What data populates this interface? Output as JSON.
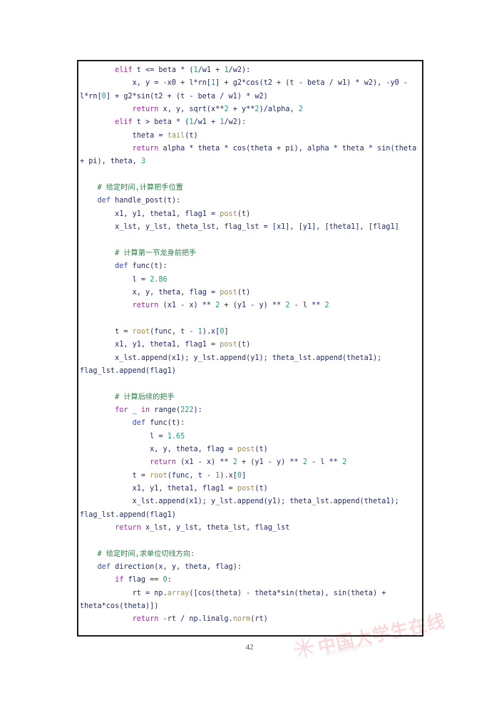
{
  "page": {
    "number": "42",
    "language": "python"
  },
  "watermark": {
    "star": "✳",
    "text_cn": "中国大学生在线",
    "url": "dxs.moe.gov.cn"
  },
  "code": {
    "lines": [
      [
        {
          "t": "        ",
          "c": "op"
        },
        {
          "t": "elif",
          "c": "kw"
        },
        {
          "t": " t <= beta * (",
          "c": "id"
        },
        {
          "t": "1",
          "c": "num"
        },
        {
          "t": "/w1 + ",
          "c": "id"
        },
        {
          "t": "1",
          "c": "num"
        },
        {
          "t": "/w2):",
          "c": "id"
        }
      ],
      [
        {
          "t": "            x, y = -x0 + l*rn[",
          "c": "id"
        },
        {
          "t": "1",
          "c": "num"
        },
        {
          "t": "] + g2*cos(t2 + (t - beta / w1) * w2), -y0 - l*rn[",
          "c": "id"
        },
        {
          "t": "0",
          "c": "num"
        },
        {
          "t": "] + g2*sin(t2 + (t - beta / w1) * w2)",
          "c": "id"
        }
      ],
      [
        {
          "t": "            ",
          "c": "op"
        },
        {
          "t": "return",
          "c": "kw"
        },
        {
          "t": " x, y, ",
          "c": "id"
        },
        {
          "t": "sqrt",
          "c": "id"
        },
        {
          "t": "(x**",
          "c": "id"
        },
        {
          "t": "2",
          "c": "num"
        },
        {
          "t": " + y**",
          "c": "id"
        },
        {
          "t": "2",
          "c": "num"
        },
        {
          "t": ")/alpha, ",
          "c": "id"
        },
        {
          "t": "2",
          "c": "num"
        }
      ],
      [
        {
          "t": "        ",
          "c": "op"
        },
        {
          "t": "elif",
          "c": "kw"
        },
        {
          "t": " t > beta * (",
          "c": "id"
        },
        {
          "t": "1",
          "c": "num"
        },
        {
          "t": "/w1 + ",
          "c": "id"
        },
        {
          "t": "1",
          "c": "num"
        },
        {
          "t": "/w2):",
          "c": "id"
        }
      ],
      [
        {
          "t": "            theta = ",
          "c": "id"
        },
        {
          "t": "tail",
          "c": "fn"
        },
        {
          "t": "(t)",
          "c": "id"
        }
      ],
      [
        {
          "t": "            ",
          "c": "op"
        },
        {
          "t": "return",
          "c": "kw"
        },
        {
          "t": " alpha * theta * cos(theta + pi), alpha * theta * sin(theta + pi), theta, ",
          "c": "id"
        },
        {
          "t": "3",
          "c": "num"
        }
      ],
      [],
      [
        {
          "t": "    ",
          "c": "op"
        },
        {
          "t": "# 给定时间,计算把手位置",
          "c": "com"
        }
      ],
      [
        {
          "t": "    ",
          "c": "op"
        },
        {
          "t": "def",
          "c": "kwd"
        },
        {
          "t": " handle_post(t):",
          "c": "id"
        }
      ],
      [
        {
          "t": "        x1, y1, theta1, flag1 = ",
          "c": "id"
        },
        {
          "t": "post",
          "c": "fn"
        },
        {
          "t": "(t)",
          "c": "id"
        }
      ],
      [
        {
          "t": "        x_lst, y_lst, theta_lst, flag_lst = [x1], [y1], [theta1], [flag1]",
          "c": "id"
        }
      ],
      [],
      [
        {
          "t": "        ",
          "c": "op"
        },
        {
          "t": "# 计算第一节龙身前把手",
          "c": "com"
        }
      ],
      [
        {
          "t": "        ",
          "c": "op"
        },
        {
          "t": "def",
          "c": "kwd"
        },
        {
          "t": " func(t):",
          "c": "id"
        }
      ],
      [
        {
          "t": "            l = ",
          "c": "id"
        },
        {
          "t": "2.86",
          "c": "num"
        }
      ],
      [
        {
          "t": "            x, y, theta, flag = ",
          "c": "id"
        },
        {
          "t": "post",
          "c": "fn"
        },
        {
          "t": "(t)",
          "c": "id"
        }
      ],
      [
        {
          "t": "            ",
          "c": "op"
        },
        {
          "t": "return",
          "c": "kw"
        },
        {
          "t": " (x1 - x) ** ",
          "c": "id"
        },
        {
          "t": "2",
          "c": "num"
        },
        {
          "t": " + (y1 - y) ** ",
          "c": "id"
        },
        {
          "t": "2",
          "c": "num"
        },
        {
          "t": " - l ** ",
          "c": "id"
        },
        {
          "t": "2",
          "c": "num"
        }
      ],
      [],
      [
        {
          "t": "        t = ",
          "c": "id"
        },
        {
          "t": "root",
          "c": "fn"
        },
        {
          "t": "(func, t - ",
          "c": "id"
        },
        {
          "t": "1",
          "c": "num"
        },
        {
          "t": ").x[",
          "c": "id"
        },
        {
          "t": "0",
          "c": "num"
        },
        {
          "t": "]",
          "c": "id"
        }
      ],
      [
        {
          "t": "        x1, y1, theta1, flag1 = ",
          "c": "id"
        },
        {
          "t": "post",
          "c": "fn"
        },
        {
          "t": "(t)",
          "c": "id"
        }
      ],
      [
        {
          "t": "        x_lst.append(x1); y_lst.append(y1); theta_lst.append(theta1); flag_lst.append(flag1)",
          "c": "id"
        }
      ],
      [],
      [
        {
          "t": "        ",
          "c": "op"
        },
        {
          "t": "# 计算后续的把手",
          "c": "com"
        }
      ],
      [
        {
          "t": "        ",
          "c": "op"
        },
        {
          "t": "for",
          "c": "kw"
        },
        {
          "t": " _ ",
          "c": "id"
        },
        {
          "t": "in",
          "c": "kw"
        },
        {
          "t": " range(",
          "c": "id"
        },
        {
          "t": "222",
          "c": "num"
        },
        {
          "t": "):",
          "c": "id"
        }
      ],
      [
        {
          "t": "            ",
          "c": "op"
        },
        {
          "t": "def",
          "c": "kwd"
        },
        {
          "t": " func(t):",
          "c": "id"
        }
      ],
      [
        {
          "t": "                l = ",
          "c": "id"
        },
        {
          "t": "1.65",
          "c": "num"
        }
      ],
      [
        {
          "t": "                x, y, theta, flag = ",
          "c": "id"
        },
        {
          "t": "post",
          "c": "fn"
        },
        {
          "t": "(t)",
          "c": "id"
        }
      ],
      [
        {
          "t": "                ",
          "c": "op"
        },
        {
          "t": "return",
          "c": "kw"
        },
        {
          "t": " (x1 - x) ** ",
          "c": "id"
        },
        {
          "t": "2",
          "c": "num"
        },
        {
          "t": " + (y1 - y) ** ",
          "c": "id"
        },
        {
          "t": "2",
          "c": "num"
        },
        {
          "t": " - l ** ",
          "c": "id"
        },
        {
          "t": "2",
          "c": "num"
        }
      ],
      [
        {
          "t": "            t = ",
          "c": "id"
        },
        {
          "t": "root",
          "c": "fn"
        },
        {
          "t": "(func, t - ",
          "c": "id"
        },
        {
          "t": "1",
          "c": "num"
        },
        {
          "t": ").x[",
          "c": "id"
        },
        {
          "t": "0",
          "c": "num"
        },
        {
          "t": "]",
          "c": "id"
        }
      ],
      [
        {
          "t": "            x1, y1, theta1, flag1 = ",
          "c": "id"
        },
        {
          "t": "post",
          "c": "fn"
        },
        {
          "t": "(t)",
          "c": "id"
        }
      ],
      [
        {
          "t": "            x_lst.append(x1); y_lst.append(y1); theta_lst.append(theta1); flag_lst.append(flag1)",
          "c": "id"
        }
      ],
      [
        {
          "t": "        ",
          "c": "op"
        },
        {
          "t": "return",
          "c": "kw"
        },
        {
          "t": " x_lst, y_lst, theta_lst, flag_lst",
          "c": "id"
        }
      ],
      [],
      [
        {
          "t": "    ",
          "c": "op"
        },
        {
          "t": "# 给定时间,求单位切线方向:",
          "c": "com"
        }
      ],
      [
        {
          "t": "    ",
          "c": "op"
        },
        {
          "t": "def",
          "c": "kwd"
        },
        {
          "t": " direction(x, y, theta, flag):",
          "c": "id"
        }
      ],
      [
        {
          "t": "        ",
          "c": "op"
        },
        {
          "t": "if",
          "c": "kw"
        },
        {
          "t": " flag == ",
          "c": "id"
        },
        {
          "t": "0",
          "c": "num"
        },
        {
          "t": ":",
          "c": "id"
        }
      ],
      [
        {
          "t": "            rt = np.",
          "c": "id"
        },
        {
          "t": "array",
          "c": "fn"
        },
        {
          "t": "([cos(theta) - theta*sin(theta), sin(theta) + theta*cos(theta)])",
          "c": "id"
        }
      ],
      [
        {
          "t": "            ",
          "c": "op"
        },
        {
          "t": "return",
          "c": "kw"
        },
        {
          "t": " -rt / np.linalg.",
          "c": "id"
        },
        {
          "t": "norm",
          "c": "fn"
        },
        {
          "t": "(rt)",
          "c": "id"
        }
      ]
    ]
  }
}
